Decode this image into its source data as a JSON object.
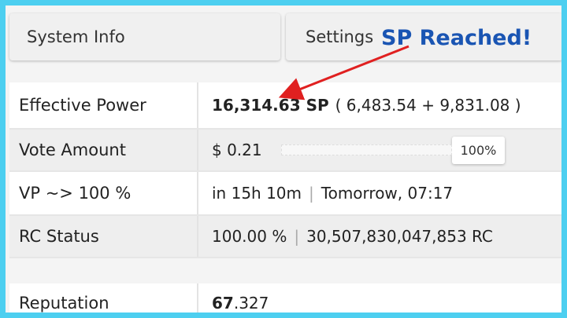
{
  "tabs": {
    "system_info": "System Info",
    "settings": "Settings"
  },
  "annotation": {
    "text": "SP Reached!",
    "color": "#1a55b3",
    "arrow_color": "#e02020"
  },
  "rows": {
    "effective_power": {
      "label": "Effective Power",
      "sp_value": "16,314.63 SP",
      "breakdown": "( 6,483.54 + 9,831.08 )"
    },
    "vote_amount": {
      "label": "Vote Amount",
      "value": "$ 0.21",
      "percent_label": "100%",
      "percent": 100
    },
    "vp_full": {
      "label": "VP ~> 100 %",
      "in_time": "in 15h 10m",
      "separator": "|",
      "when": "Tomorrow, 07:17"
    },
    "rc_status": {
      "label": "RC Status",
      "percent": "100.00 %",
      "separator": "|",
      "rc_amount": "30,507,830,047,853 RC"
    },
    "reputation": {
      "label": "Reputation",
      "value_int": "67",
      "value_dec": ".327"
    }
  },
  "colors": {
    "frame_border": "#4dcff0",
    "row_alt_bg": "#eeeeee"
  }
}
